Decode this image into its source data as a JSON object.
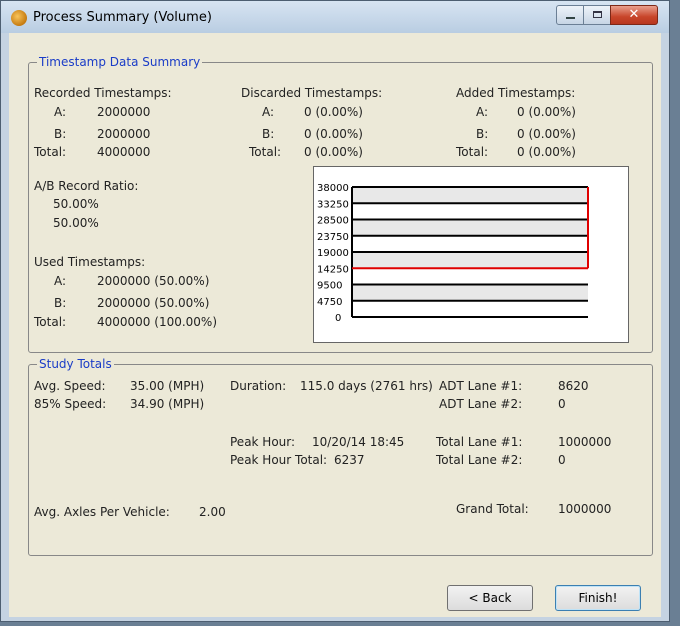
{
  "window": {
    "title": "Process Summary (Volume)"
  },
  "timestamp_group": {
    "legend": "Timestamp Data Summary",
    "recorded": {
      "heading": "Recorded Timestamps:",
      "a_label": "A:",
      "a": "2000000",
      "b_label": "B:",
      "b": "2000000",
      "total_label": "Total:",
      "total": "4000000"
    },
    "discarded": {
      "heading": "Discarded Timestamps:",
      "a_label": "A:",
      "a": "0 (0.00%)",
      "b_label": "B:",
      "b": "0 (0.00%)",
      "total_label": "Total:",
      "total": "0 (0.00%)"
    },
    "added": {
      "heading": "Added Timestamps:",
      "a_label": "A:",
      "a": "0 (0.00%)",
      "b_label": "B:",
      "b": "0 (0.00%)",
      "total_label": "Total:",
      "total": "0 (0.00%)"
    },
    "ratio": {
      "heading": "A/B Record Ratio:",
      "a": "50.00%",
      "b": "50.00%"
    },
    "used": {
      "heading": "Used Timestamps:",
      "a_label": "A:",
      "a": "2000000 (50.00%)",
      "b_label": "B:",
      "b": "2000000 (50.00%)",
      "total_label": "Total:",
      "total": "4000000 (100.00%)"
    }
  },
  "chart_data": {
    "type": "bar",
    "orientation": "horizontal",
    "ticks": [
      "38000",
      "33250",
      "28500",
      "23750",
      "19000",
      "14250",
      "9500",
      "4750",
      "0"
    ],
    "ylim": [
      0,
      38000
    ],
    "marker_value": 14250,
    "colors": {
      "bars": "#000000",
      "marker": "#e00000",
      "grid_fill": "#e8e8e8"
    }
  },
  "study_totals": {
    "legend": "Study Totals",
    "avg_speed_label": "Avg. Speed:",
    "avg_speed": "35.00 (MPH)",
    "speed85_label": "85% Speed:",
    "speed85": "34.90 (MPH)",
    "duration_label": "Duration:",
    "duration": "115.0 days (2761 hrs)",
    "adt1_label": "ADT Lane #1:",
    "adt1": "8620",
    "adt2_label": "ADT Lane #2:",
    "adt2": "0",
    "peak_hour_label": "Peak Hour:",
    "peak_hour": "10/20/14 18:45",
    "peak_total_label": "Peak Hour Total:",
    "peak_total": "6237",
    "total1_label": "Total Lane #1:",
    "total1": "1000000",
    "total2_label": "Total Lane #2:",
    "total2": "0",
    "axles_label": "Avg. Axles Per Vehicle:",
    "axles": "2.00",
    "grand_label": "Grand Total:",
    "grand": "1000000"
  },
  "buttons": {
    "back": "< Back",
    "finish": "Finish!"
  }
}
